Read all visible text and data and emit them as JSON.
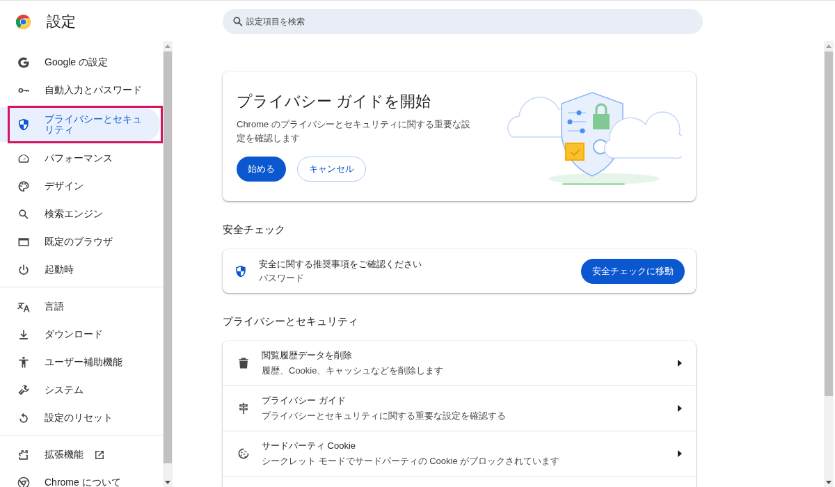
{
  "header": {
    "title": "設定",
    "search": {
      "placeholder": "設定項目を検索"
    }
  },
  "sidebar": {
    "groups": [
      [
        {
          "label": "Google の設定",
          "selected": false,
          "highlighted": false,
          "external_link": false
        },
        {
          "label": "自動入力とパスワード",
          "selected": false,
          "highlighted": false,
          "external_link": false
        },
        {
          "label": "プライバシーとセキュリティ",
          "selected": true,
          "highlighted": true,
          "external_link": false
        },
        {
          "label": "パフォーマンス",
          "selected": false,
          "highlighted": false,
          "external_link": false
        },
        {
          "label": "デザイン",
          "selected": false,
          "highlighted": false,
          "external_link": false
        },
        {
          "label": "検索エンジン",
          "selected": false,
          "highlighted": false,
          "external_link": false
        },
        {
          "label": "既定のブラウザ",
          "selected": false,
          "highlighted": false,
          "external_link": false
        },
        {
          "label": "起動時",
          "selected": false,
          "highlighted": false,
          "external_link": false
        }
      ],
      [
        {
          "label": "言語",
          "selected": false,
          "highlighted": false,
          "external_link": false
        },
        {
          "label": "ダウンロード",
          "selected": false,
          "highlighted": false,
          "external_link": false
        },
        {
          "label": "ユーザー補助機能",
          "selected": false,
          "highlighted": false,
          "external_link": false
        },
        {
          "label": "システム",
          "selected": false,
          "highlighted": false,
          "external_link": false
        },
        {
          "label": "設定のリセット",
          "selected": false,
          "highlighted": false,
          "external_link": false
        }
      ],
      [
        {
          "label": "拡張機能",
          "selected": false,
          "highlighted": false,
          "external_link": true
        },
        {
          "label": "Chrome について",
          "selected": false,
          "highlighted": false,
          "external_link": false
        }
      ]
    ]
  },
  "guide_card": {
    "title": "プライバシー ガイドを開始",
    "description": "Chrome のプライバシーとセキュリティに関する重要な設定を確認します",
    "buttons": [
      {
        "label": "始める",
        "kind": "primary"
      },
      {
        "label": "キャンセル",
        "kind": "outline"
      }
    ]
  },
  "safety_check": {
    "heading": "安全チェック",
    "message": "安全に関する推奨事項をご確認ください",
    "detail": "パスワード",
    "button": "安全チェックに移動"
  },
  "privacy": {
    "heading": "プライバシーとセキュリティ",
    "rows": [
      {
        "title": "閲覧履歴データを削除",
        "subtitle": "履歴、Cookie、キャッシュなどを削除します"
      },
      {
        "title": "プライバシー ガイド",
        "subtitle": "プライバシーとセキュリティに関する重要な設定を確認する"
      },
      {
        "title": "サードパーティ Cookie",
        "subtitle": "シークレット モードでサードパーティの Cookie がブロックされています"
      }
    ]
  }
}
